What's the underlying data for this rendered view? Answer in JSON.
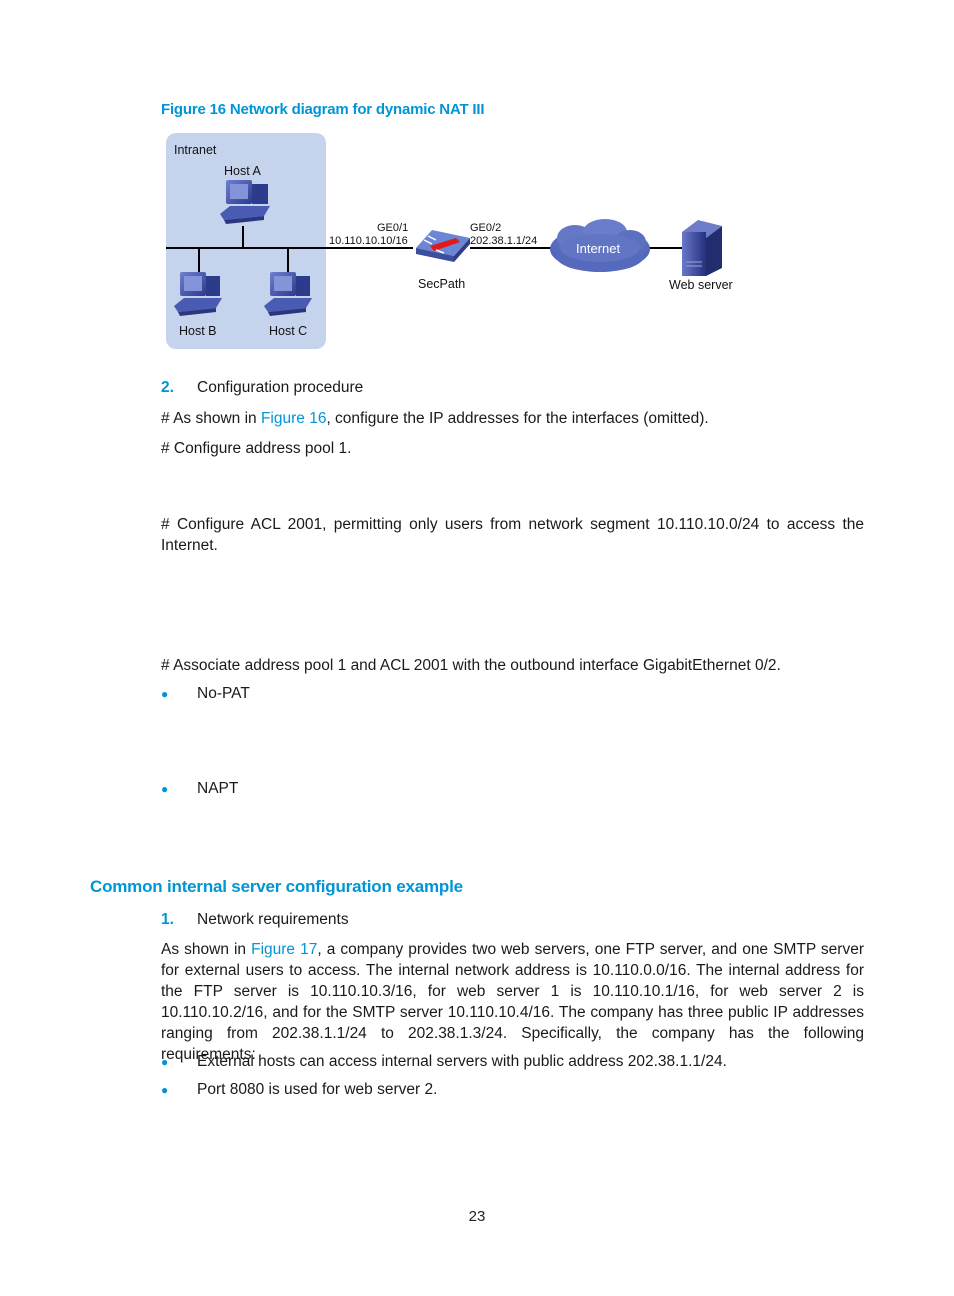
{
  "figure": {
    "title": "Figure 16 Network diagram for dynamic NAT III",
    "intranet_label": "Intranet",
    "hosts": [
      "Host A",
      "Host B",
      "Host C"
    ],
    "ge01_label": "GE0/1",
    "ge01_ip": "10.110.10.10/16",
    "ge02_label": "GE0/2",
    "ge02_ip": "202.38.1.1/24",
    "firewall_label": "SecPath",
    "cloud_label": "Internet",
    "server_label": "Web server"
  },
  "procedure": {
    "number": "2.",
    "title": "Configuration procedure",
    "line1_prefix": "# As shown in ",
    "line1_link": "Figure 16",
    "line1_suffix": ", configure the IP addresses for the interfaces (omitted).",
    "line2": "# Configure address pool 1.",
    "line3": "# Configure ACL 2001, permitting only users from network segment 10.110.10.0/24 to access the Internet.",
    "line4": "# Associate address pool 1 and ACL 2001 with the outbound interface GigabitEthernet 0/2.",
    "bullets": [
      "No-PAT",
      "NAPT"
    ]
  },
  "section": {
    "heading": "Common internal server configuration example",
    "number": "1.",
    "subtitle": "Network requirements",
    "para_prefix": "As shown in ",
    "para_link": "Figure 17",
    "para_suffix": ", a company provides two web servers, one FTP server, and one SMTP server for external users to access. The internal network address is 10.110.0.0/16. The internal address for the FTP server is 10.110.10.3/16, for web server 1 is 10.110.10.1/16, for web server 2 is 10.110.10.2/16, and for the SMTP server 10.110.10.4/16. The company has three public IP addresses ranging from 202.38.1.1/24 to 202.38.1.3/24. Specifically, the company has the following requirements:",
    "bullets": [
      "External hosts can access internal servers with public address 202.38.1.1/24.",
      "Port 8080 is used for web server 2."
    ]
  },
  "page_number": "23",
  "colors": {
    "accent": "#0096d6",
    "intranet_bg": "#c5d3ec",
    "device": "#3d4fa3"
  }
}
